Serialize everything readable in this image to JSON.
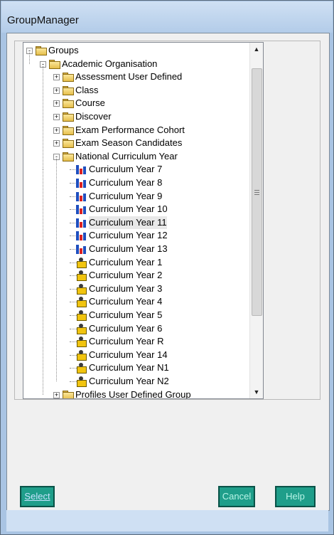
{
  "window": {
    "title": "GroupManager"
  },
  "tree": {
    "root": "Groups",
    "org": "Academic Organisation",
    "folders": [
      "Assessment User Defined",
      "Class",
      "Course",
      "Discover",
      "Exam Performance Cohort",
      "Exam Season Candidates",
      "National Curriculum Year"
    ],
    "year_items_chart": [
      "Curriculum Year  7",
      "Curriculum Year  8",
      "Curriculum Year  9",
      "Curriculum Year 10",
      "Curriculum Year 11",
      "Curriculum Year 12",
      "Curriculum Year 13"
    ],
    "year_items_user": [
      "Curriculum Year  1",
      "Curriculum Year  2",
      "Curriculum Year  3",
      "Curriculum Year  4",
      "Curriculum Year  5",
      "Curriculum Year  6",
      "Curriculum Year  R",
      "Curriculum Year 14",
      "Curriculum Year N1",
      "Curriculum Year N2"
    ],
    "partial_item": "Profiles User Defined Group",
    "selected_item": "Curriculum Year 11"
  },
  "buttons": {
    "select": "Select",
    "cancel": "Cancel",
    "help": "Help"
  },
  "colors": {
    "button_bg": "#1f9e8a",
    "title_bg": "#b3cce9"
  }
}
